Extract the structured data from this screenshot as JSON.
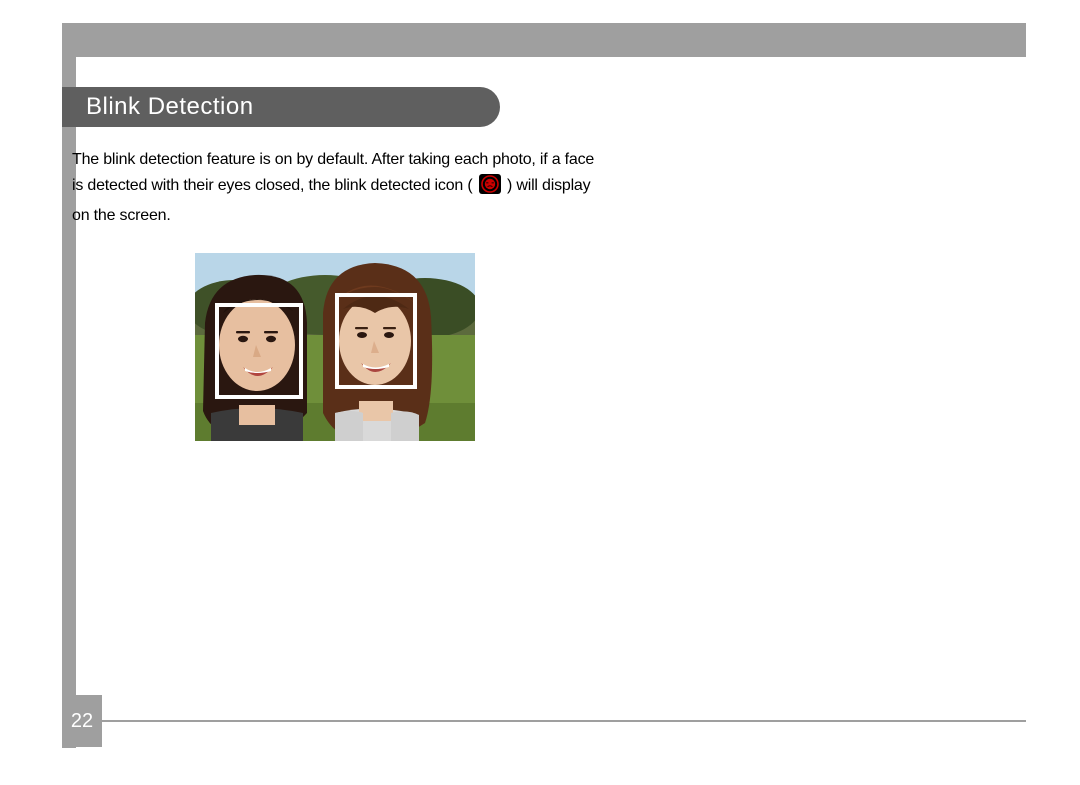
{
  "section": {
    "title": "Blink Detection"
  },
  "body": {
    "part1": "The blink detection feature is on by default. After taking each photo, if a face is detected with their eyes closed, the blink detected icon (",
    "part2": ") will display on the screen."
  },
  "icon": {
    "name": "blink-detected-icon",
    "colors": {
      "bg": "#000000",
      "ring": "#cc0000",
      "face": "#cc0000"
    }
  },
  "image": {
    "description": "Sample photo of two people outdoors with white face-detection boxes drawn over each face"
  },
  "page_number": "22"
}
